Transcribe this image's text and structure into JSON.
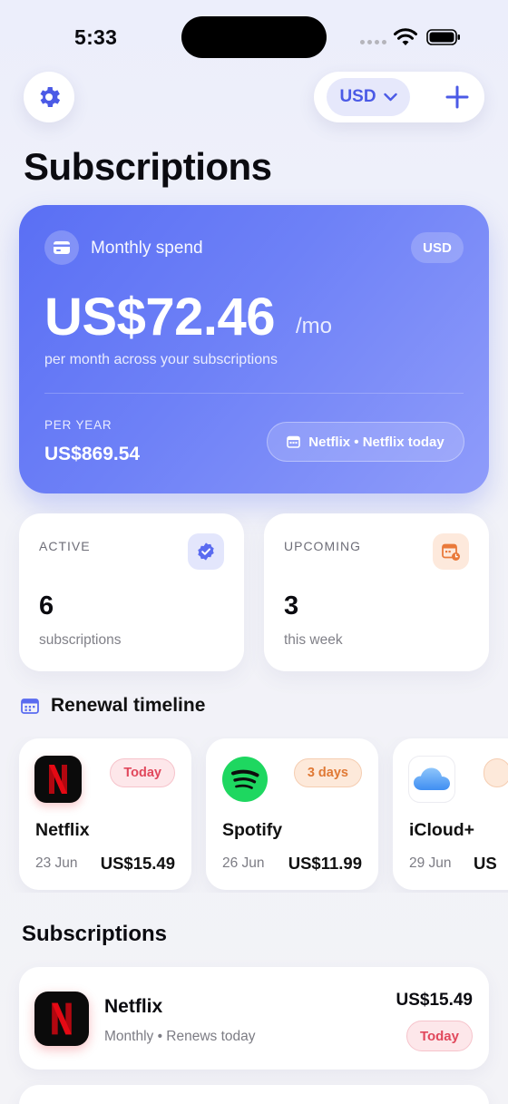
{
  "status_bar": {
    "time": "5:33"
  },
  "header": {
    "currency": "USD",
    "title": "Subscriptions"
  },
  "hero": {
    "label": "Monthly spend",
    "currency_badge": "USD",
    "amount": "US$72.46",
    "per": "/mo",
    "subtitle": "per month across your subscriptions",
    "year_label": "PER YEAR",
    "year_value": "US$869.54",
    "next_label": "Netflix • Netflix today"
  },
  "stats": {
    "active": {
      "label": "ACTIVE",
      "value": "6",
      "sub": "subscriptions"
    },
    "upcoming": {
      "label": "UPCOMING",
      "value": "3",
      "sub": "this week"
    }
  },
  "timeline": {
    "title": "Renewal timeline",
    "items": [
      {
        "name": "Netflix",
        "badge": "Today",
        "date": "23 Jun",
        "price": "US$15.49"
      },
      {
        "name": "Spotify",
        "badge": "3 days",
        "date": "26 Jun",
        "price": "US$11.99"
      },
      {
        "name": "iCloud+",
        "badge": "",
        "date": "29 Jun",
        "price": "US"
      }
    ]
  },
  "subscriptions": {
    "title": "Subscriptions",
    "items": [
      {
        "name": "Netflix",
        "meta": "Monthly • Renews today",
        "price": "US$15.49",
        "badge": "Today"
      }
    ]
  },
  "colors": {
    "accent": "#4b5ae6",
    "netflix": "#e50914",
    "spotify": "#1ed760"
  }
}
